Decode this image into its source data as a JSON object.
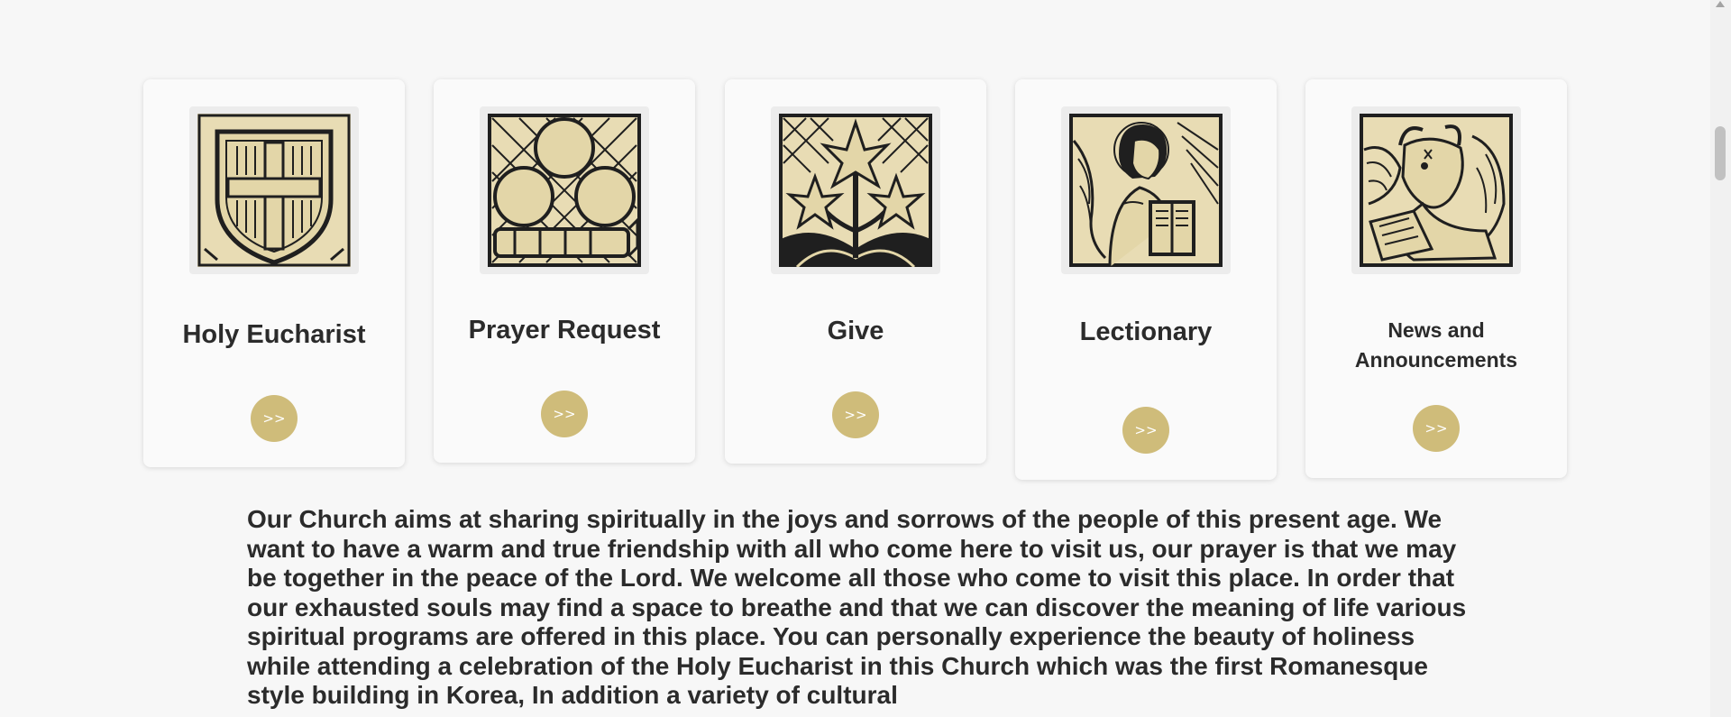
{
  "cards": [
    {
      "title": "Holy Eucharist",
      "button_label": ">>",
      "icon": "shield-cross-icon"
    },
    {
      "title": "Prayer Request",
      "button_label": ">>",
      "icon": "three-spheres-book-icon"
    },
    {
      "title": "Give",
      "button_label": ">>",
      "icon": "lilies-icon"
    },
    {
      "title": "Lectionary",
      "button_label": ">>",
      "icon": "angel-reading-icon"
    },
    {
      "title": "News and Announcements",
      "button_label": ">>",
      "icon": "winged-ox-icon"
    }
  ],
  "intro_text": "Our Church aims at sharing spiritually in the joys and sorrows of the people of this present age. We want to have a warm and true friendship with all who come here to visit us, our prayer is that we may be together in the peace of the Lord. We welcome all those who come to visit this place. In order that our exhausted souls may find a space to breathe and that we can discover the meaning of life various spiritual programs are offered in this place. You can personally experience the beauty of holiness while attending a celebration of the Holy Eucharist in this Church which was the first Romanesque style building in Korea, In addition a variety of cultural",
  "colors": {
    "accent": "#cfbc7a",
    "card_bg": "#fafafa",
    "page_bg": "#f7f7f7",
    "text": "#2b2b2b",
    "art_bg": "#e8dcb4",
    "ink": "#1f1f1f"
  }
}
